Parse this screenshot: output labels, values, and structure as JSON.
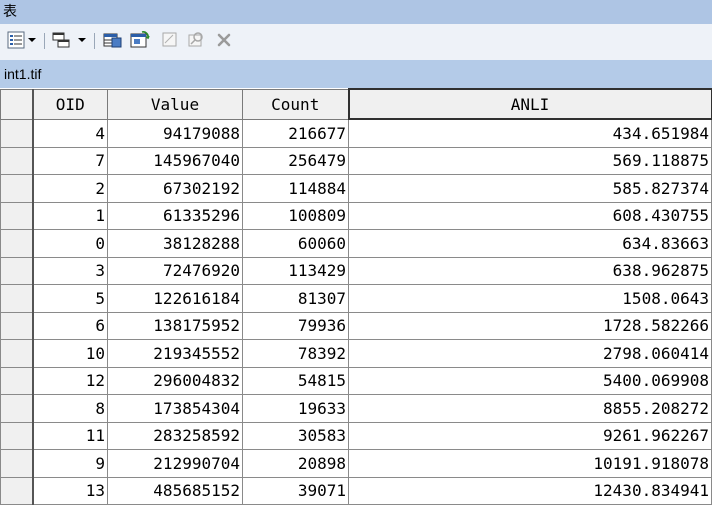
{
  "window": {
    "title": "表"
  },
  "toolbar": {
    "icons": [
      "table-options-icon",
      "dropdown-arrow-icon",
      "related-tables-icon",
      "dropdown-arrow-icon",
      "select-by-attributes-icon",
      "switch-selection-icon",
      "clear-selection-icon",
      "zoom-to-selected-icon",
      "delete-selected-icon"
    ]
  },
  "tab": {
    "label": "int1.tif"
  },
  "table": {
    "columns": [
      "OID",
      "Value",
      "Count",
      "ANLI"
    ],
    "rows": [
      [
        "4",
        "94179088",
        "216677",
        "434.651984"
      ],
      [
        "7",
        "145967040",
        "256479",
        "569.118875"
      ],
      [
        "2",
        "67302192",
        "114884",
        "585.827374"
      ],
      [
        "1",
        "61335296",
        "100809",
        "608.430755"
      ],
      [
        "0",
        "38128288",
        "60060",
        "634.83663"
      ],
      [
        "3",
        "72476920",
        "113429",
        "638.962875"
      ],
      [
        "5",
        "122616184",
        "81307",
        "1508.0643"
      ],
      [
        "6",
        "138175952",
        "79936",
        "1728.582266"
      ],
      [
        "10",
        "219345552",
        "78392",
        "2798.060414"
      ],
      [
        "12",
        "296004832",
        "54815",
        "5400.069908"
      ],
      [
        "8",
        "173854304",
        "19633",
        "8855.208272"
      ],
      [
        "11",
        "283258592",
        "30583",
        "9261.962267"
      ],
      [
        "9",
        "212990704",
        "20898",
        "10191.918078"
      ],
      [
        "13",
        "485685152",
        "39071",
        "12430.834941"
      ]
    ]
  }
}
